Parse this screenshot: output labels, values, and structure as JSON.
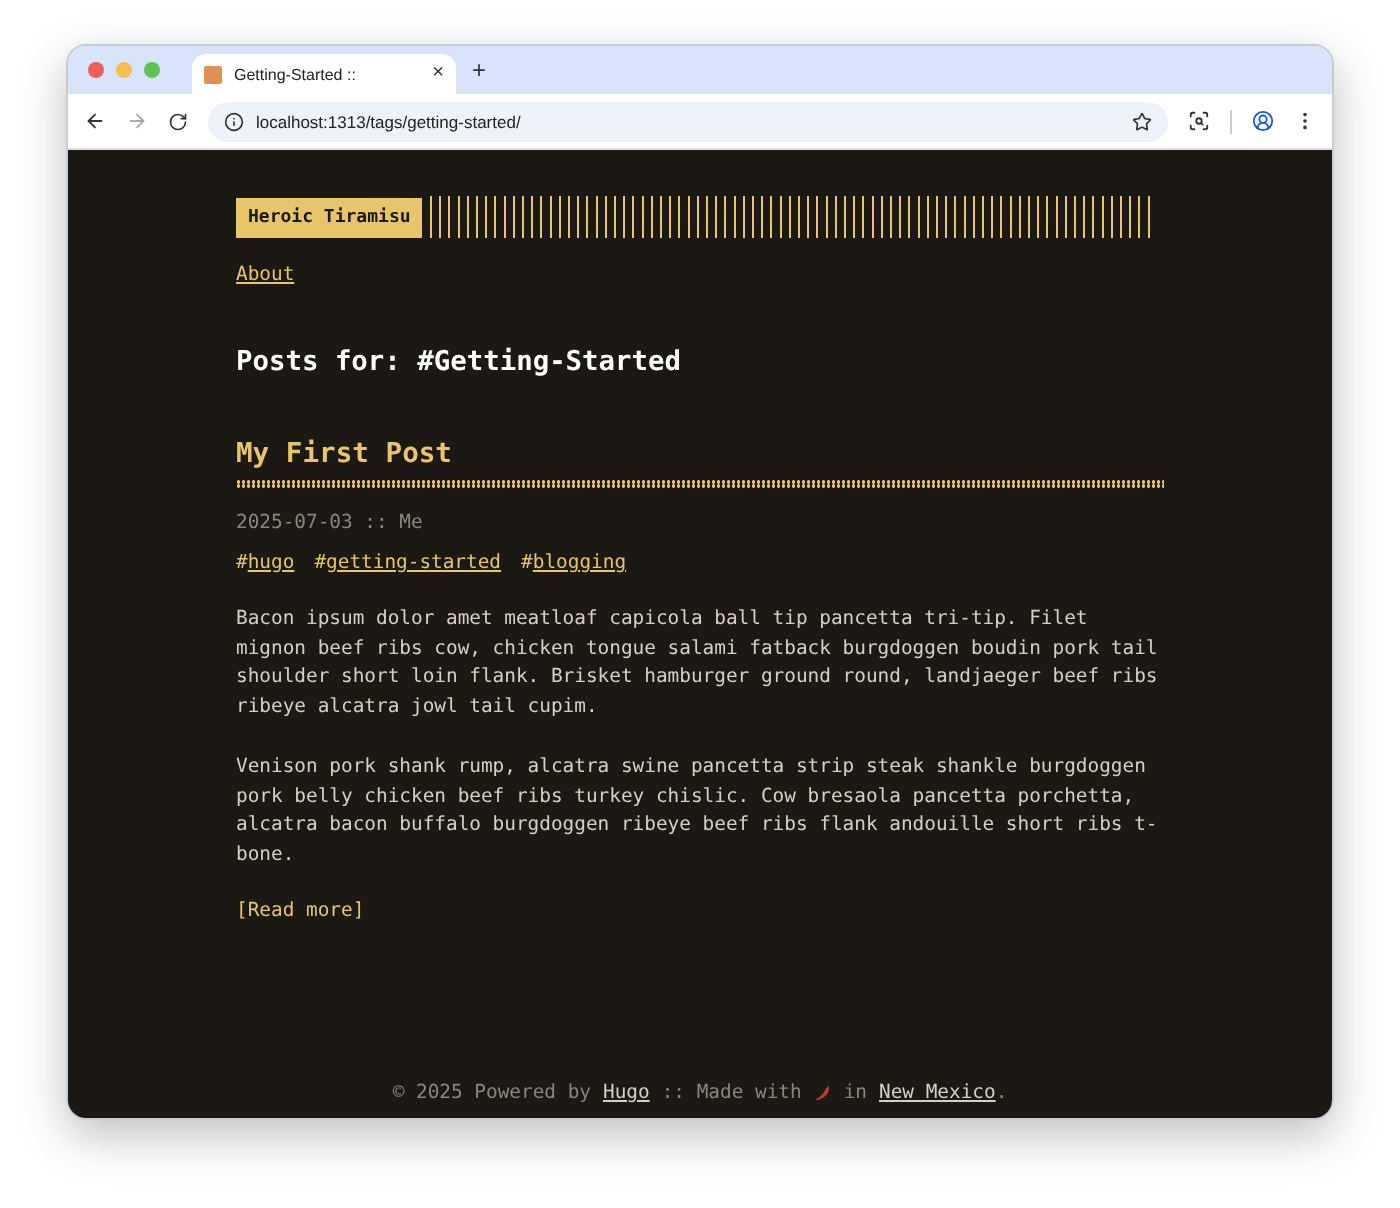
{
  "browser": {
    "tab": {
      "title": "Getting-Started ::",
      "close": "×"
    },
    "new_tab": "+",
    "address": "localhost:1313/tags/getting-started/"
  },
  "site": {
    "logo": "Heroic Tiramisu",
    "menu": [
      {
        "label": "About"
      }
    ]
  },
  "heading": "Posts for: #Getting-Started",
  "posts": [
    {
      "title": "My First Post",
      "meta": "2025-07-03 :: Me",
      "tags": [
        {
          "prefix": "#",
          "label": "hugo"
        },
        {
          "prefix": "#",
          "label": "getting-started"
        },
        {
          "prefix": "#",
          "label": "blogging"
        }
      ],
      "paragraphs": [
        "Bacon ipsum dolor amet meatloaf capicola ball tip pancetta tri-tip. Filet mignon beef ribs cow, chicken tongue salami fatback burgdoggen boudin pork tail shoulder short loin flank. Brisket hamburger ground round, landjaeger beef ribs ribeye alcatra jowl tail cupim.",
        "Venison pork shank rump, alcatra swine pancetta strip steak shankle burgdoggen pork belly chicken beef ribs turkey chislic. Cow bresaola pancetta porchetta, alcatra bacon buffalo burgdoggen ribeye beef ribs flank andouille short ribs t-bone."
      ],
      "read_more": "[Read more]"
    }
  ],
  "footer": {
    "before": "© 2025 Powered by",
    "link1": "Hugo",
    "middle": ":: Made with",
    "after": "in",
    "link2": "New Mexico",
    "end": "."
  }
}
